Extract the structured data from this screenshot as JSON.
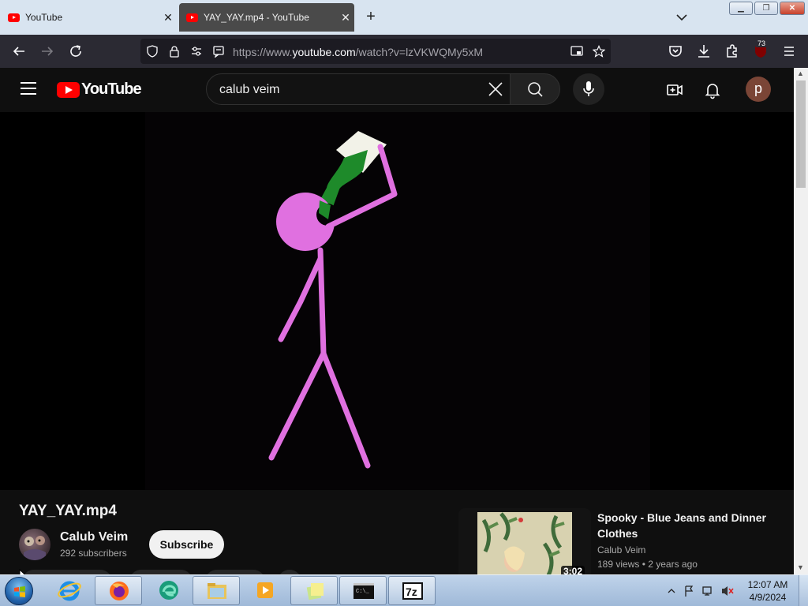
{
  "browser": {
    "tabs": [
      {
        "label": "YouTube",
        "active": false
      },
      {
        "label": "YAY_YAY.mp4 - YouTube",
        "active": true
      }
    ],
    "url_prefix": "https://www.",
    "url_domain": "youtube.com",
    "url_suffix": "/watch?v=lzVKWQMy5xM",
    "extension_badge": "73"
  },
  "youtube": {
    "logo_text": "YouTube",
    "search_query": "calub veim",
    "account_initial": "p"
  },
  "video": {
    "title": "YAY_YAY.mp4",
    "channel_name": "Calub Veim",
    "subscribers": "292 subscribers",
    "subscribe_label": "Subscribe"
  },
  "recommended": [
    {
      "title": "Spooky - Blue Jeans and Dinner Clothes",
      "channel": "Calub Veim",
      "views": "189 views",
      "age": "2 years ago",
      "duration": "3:02"
    }
  ],
  "taskbar": {
    "time": "12:07 AM",
    "date": "4/9/2024",
    "apps": [
      "start-orb",
      "internet-explorer-icon",
      "firefox-icon",
      "edge-icon",
      "file-explorer-icon",
      "media-player-icon",
      "sticky-notes-icon",
      "command-prompt-icon",
      "7zip-icon"
    ]
  },
  "colors": {
    "youtube_red": "#ff0000",
    "figure_pink": "#e070e0",
    "bottle_green": "#1e8a2a"
  }
}
